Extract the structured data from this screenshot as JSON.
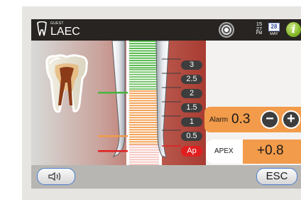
{
  "header": {
    "user_caption": "GUEST",
    "title": "LAEC",
    "time": {
      "hour": "15",
      "minute": "27",
      "period": "PM"
    },
    "date": {
      "day": "28",
      "month": "MAY"
    },
    "info_label": "i"
  },
  "scale": {
    "labels": [
      "3",
      "2.5",
      "2",
      "1.5",
      "1",
      "0.5",
      "Ap"
    ]
  },
  "alarm": {
    "label": "Alarm",
    "value": "0.3",
    "minus": "−",
    "plus": "+"
  },
  "apex": {
    "label": "APEX",
    "value": "+0.8"
  },
  "footer": {
    "esc_label": "ESC"
  },
  "colors": {
    "accent_orange": "#f29b4a",
    "apex_red": "#e02020",
    "green": "#49b43f",
    "button_border": "#4c7fd0"
  },
  "icons": [
    "tooth-icon",
    "record-icon",
    "calendar-icon",
    "info-icon",
    "speaker-icon",
    "minus-icon",
    "plus-icon"
  ]
}
